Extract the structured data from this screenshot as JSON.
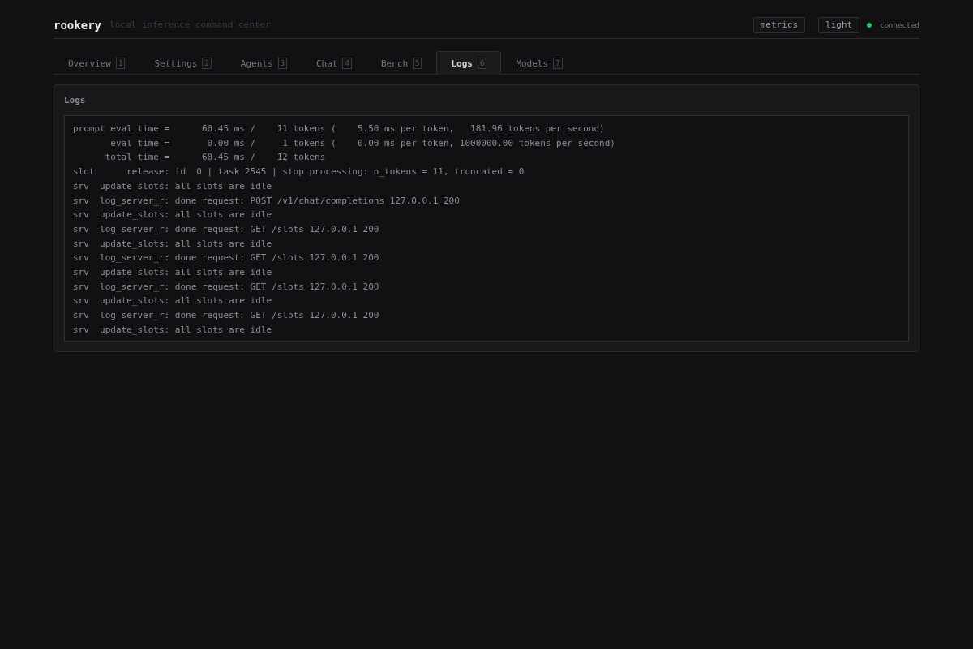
{
  "header": {
    "brand": "rookery",
    "tagline": "local inference command center",
    "buttons": [
      "metrics",
      "light"
    ],
    "status": {
      "label": "connected",
      "color": "#22c55e"
    }
  },
  "tabs": [
    {
      "label": "Overview",
      "key": "1",
      "selected": false
    },
    {
      "label": "Settings",
      "key": "2",
      "selected": false
    },
    {
      "label": "Agents",
      "key": "3",
      "selected": false
    },
    {
      "label": "Chat",
      "key": "4",
      "selected": false
    },
    {
      "label": "Bench",
      "key": "5",
      "selected": false
    },
    {
      "label": "Logs",
      "key": "6",
      "selected": true
    },
    {
      "label": "Models",
      "key": "7",
      "selected": false
    }
  ],
  "panel": {
    "title": "Logs",
    "lines": [
      "prompt eval time =      60.45 ms /    11 tokens (    5.50 ms per token,   181.96 tokens per second)",
      "       eval time =       0.00 ms /     1 tokens (    0.00 ms per token, 1000000.00 tokens per second)",
      "      total time =      60.45 ms /    12 tokens",
      "slot      release: id  0 | task 2545 | stop processing: n_tokens = 11, truncated = 0",
      "srv  update_slots: all slots are idle",
      "srv  log_server_r: done request: POST /v1/chat/completions 127.0.0.1 200",
      "srv  update_slots: all slots are idle",
      "srv  log_server_r: done request: GET /slots 127.0.0.1 200",
      "srv  update_slots: all slots are idle",
      "srv  log_server_r: done request: GET /slots 127.0.0.1 200",
      "srv  update_slots: all slots are idle",
      "srv  log_server_r: done request: GET /slots 127.0.0.1 200",
      "srv  update_slots: all slots are idle",
      "srv  log_server_r: done request: GET /slots 127.0.0.1 200",
      "srv  update_slots: all slots are idle"
    ]
  }
}
